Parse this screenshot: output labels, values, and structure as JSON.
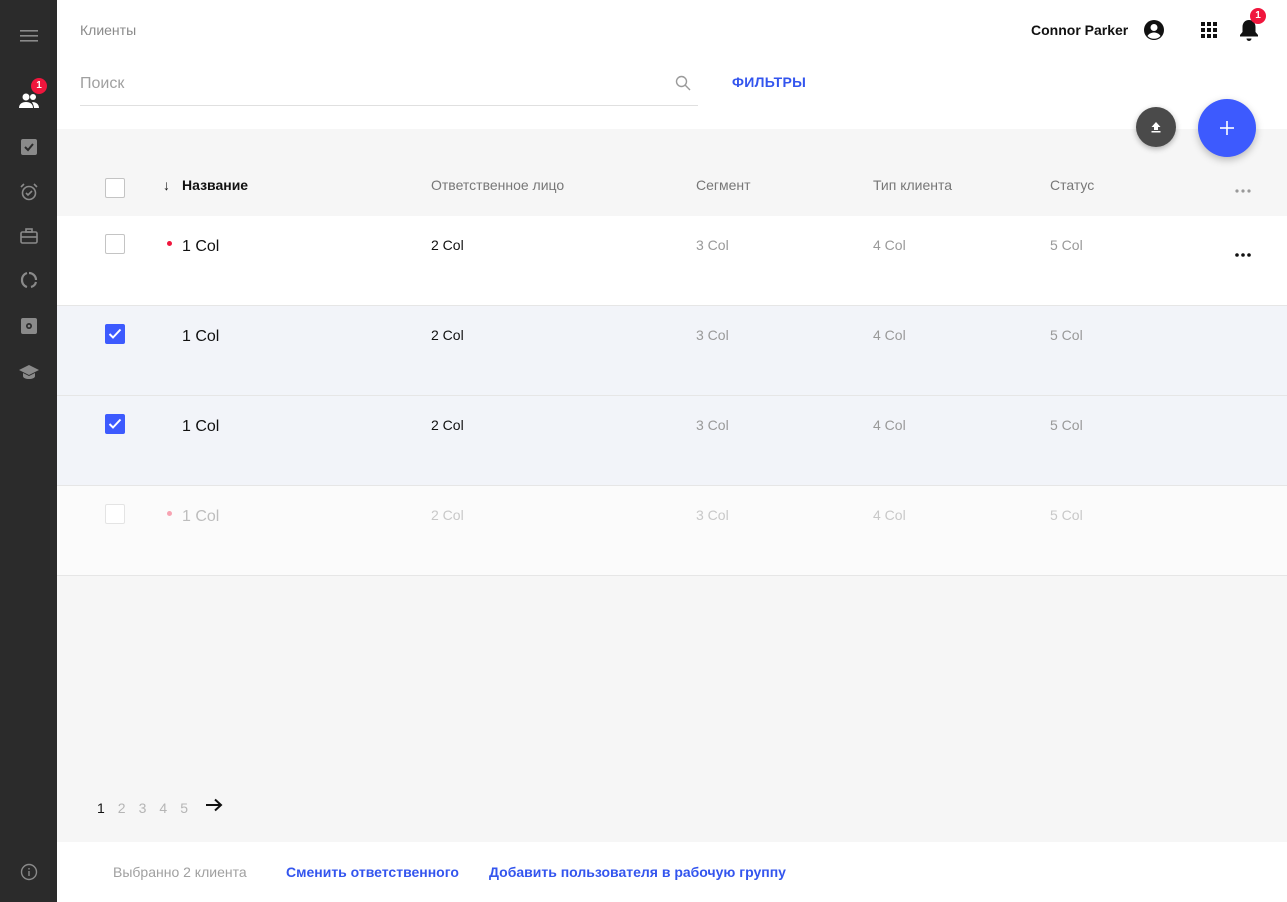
{
  "sidebar": {
    "badge_count": "1",
    "items": [
      {
        "icon": "menu-icon"
      },
      {
        "icon": "clients-icon"
      },
      {
        "icon": "tasks-icon"
      },
      {
        "icon": "alarm-icon"
      },
      {
        "icon": "briefcase-icon"
      },
      {
        "icon": "loader-icon"
      },
      {
        "icon": "settings-icon"
      },
      {
        "icon": "education-icon"
      },
      {
        "icon": "info-icon"
      }
    ]
  },
  "header": {
    "breadcrumb": "Клиенты",
    "user_name": "Connor Parker",
    "notifications_count": "1"
  },
  "search": {
    "placeholder": "Поиск",
    "filters_label": "ФИЛЬТРЫ"
  },
  "table": {
    "columns": {
      "name": "Название",
      "responsible": "Ответственное лицо",
      "segment": "Сегмент",
      "client_type": "Тип клиента",
      "status": "Статус"
    },
    "rows": [
      {
        "c1": "1 Col",
        "c2": "2 Col",
        "c3": "3 Col",
        "c4": "4 Col",
        "c5": "5 Col",
        "checked": false,
        "dot": true
      },
      {
        "c1": "1 Col",
        "c2": "2 Col",
        "c3": "3 Col",
        "c4": "4 Col",
        "c5": "5 Col",
        "checked": true,
        "dot": false
      },
      {
        "c1": "1 Col",
        "c2": "2 Col",
        "c3": "3 Col",
        "c4": "4 Col",
        "c5": "5 Col",
        "checked": true,
        "dot": false
      },
      {
        "c1": "1 Col",
        "c2": "2 Col",
        "c3": "3 Col",
        "c4": "4 Col",
        "c5": "5 Col",
        "checked": false,
        "dot": true
      }
    ]
  },
  "pagination": {
    "pages": [
      "1",
      "2",
      "3",
      "4",
      "5"
    ],
    "current": "1"
  },
  "footer": {
    "selected_text": "Выбранно 2 клиента",
    "change_responsible": "Сменить ответственного",
    "add_to_group": "Добавить пользователя в рабочую группу"
  },
  "colors": {
    "accent": "#3d5afe",
    "badge": "#f0163d",
    "sidebar": "#2b2b2b"
  }
}
